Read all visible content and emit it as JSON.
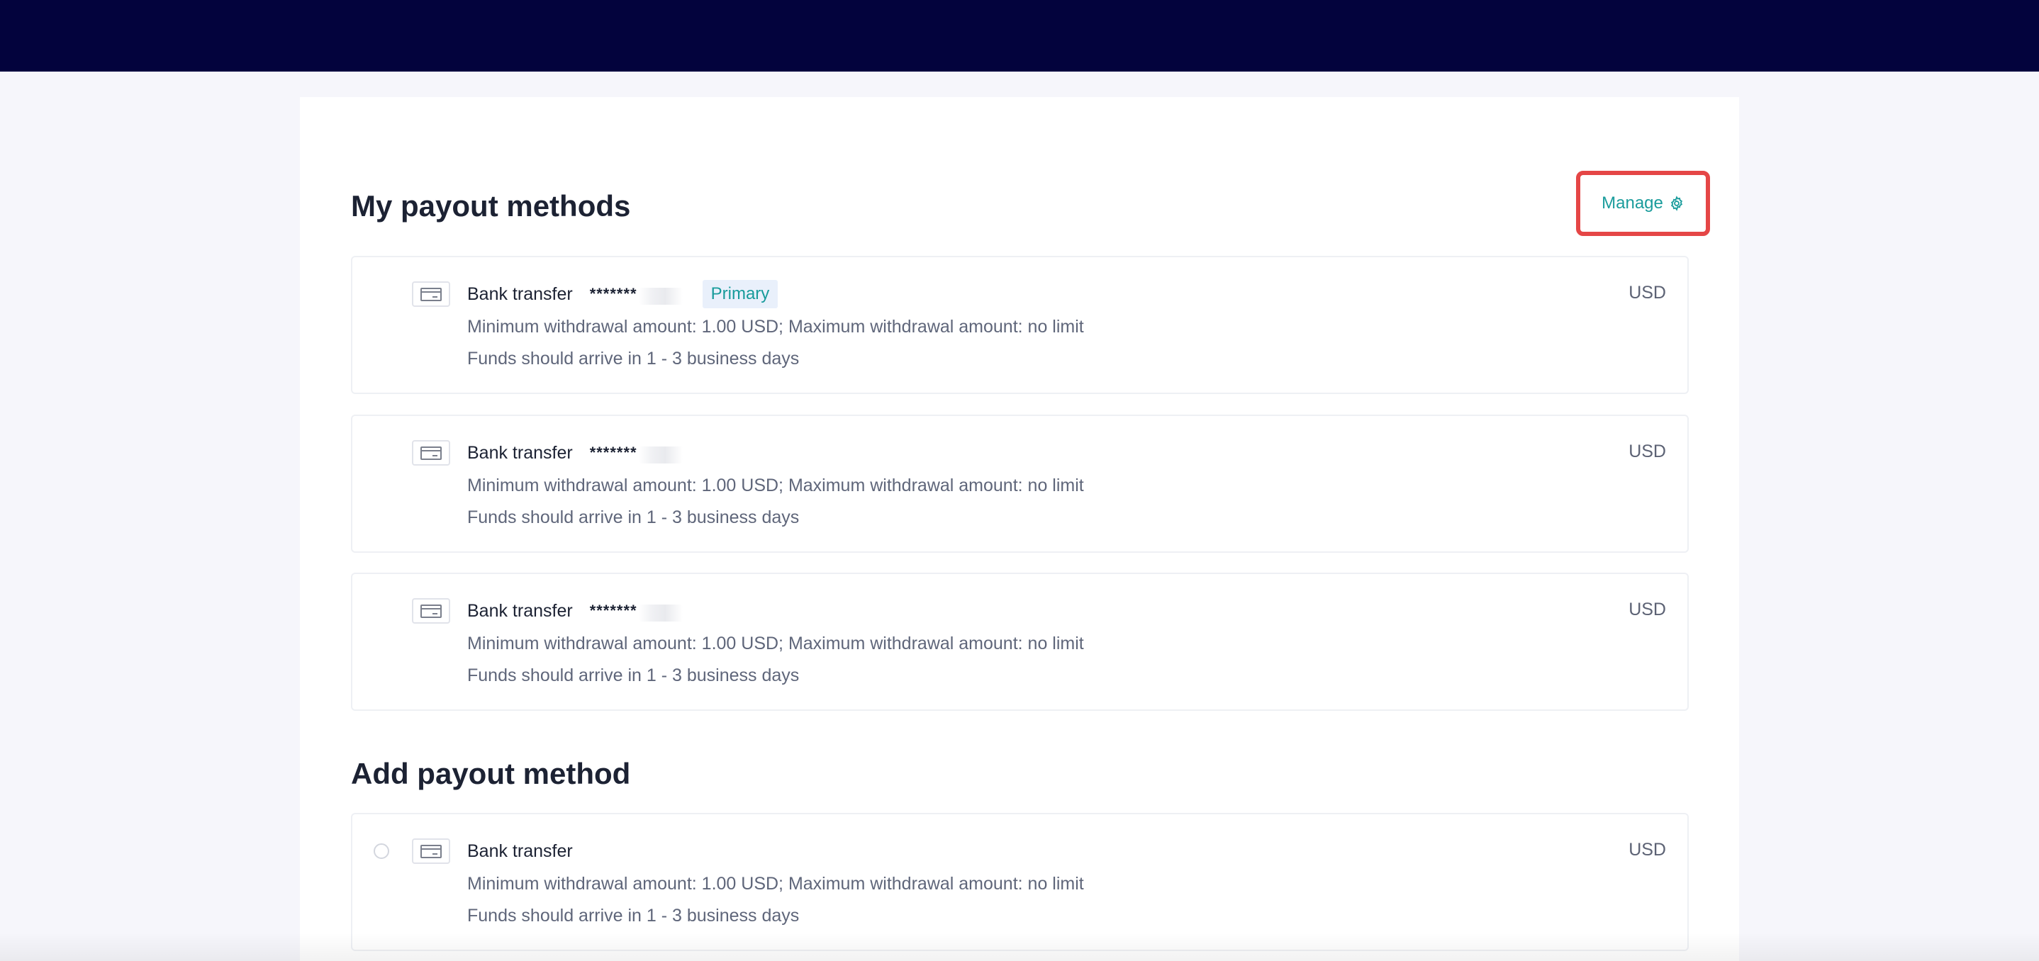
{
  "header": {
    "bar_color": "#03033d"
  },
  "payout": {
    "title": "My payout methods",
    "manage_label": "Manage",
    "manage_icon": "gear-icon",
    "methods": [
      {
        "name": "Bank transfer",
        "masked": "*******",
        "badge": "Primary",
        "currency": "USD",
        "limits": "Minimum withdrawal amount: 1.00 USD; Maximum withdrawal amount: no limit",
        "arrival": "Funds should arrive in 1 - 3 business days"
      },
      {
        "name": "Bank transfer",
        "masked": "*******",
        "currency": "USD",
        "limits": "Minimum withdrawal amount: 1.00 USD; Maximum withdrawal amount: no limit",
        "arrival": "Funds should arrive in 1 - 3 business days"
      },
      {
        "name": "Bank transfer",
        "masked": "*******",
        "currency": "USD",
        "limits": "Minimum withdrawal amount: 1.00 USD; Maximum withdrawal amount: no limit",
        "arrival": "Funds should arrive in 1 - 3 business days"
      }
    ]
  },
  "add": {
    "title": "Add payout method",
    "options": [
      {
        "name": "Bank transfer",
        "currency": "USD",
        "limits": "Minimum withdrawal amount: 1.00 USD; Maximum withdrawal amount: no limit",
        "arrival": "Funds should arrive in 1 - 3 business days",
        "selected": false
      }
    ]
  },
  "colors": {
    "accent": "#1a9c9c",
    "highlight_border": "#e54646",
    "badge_bg": "#e9f0fb"
  }
}
